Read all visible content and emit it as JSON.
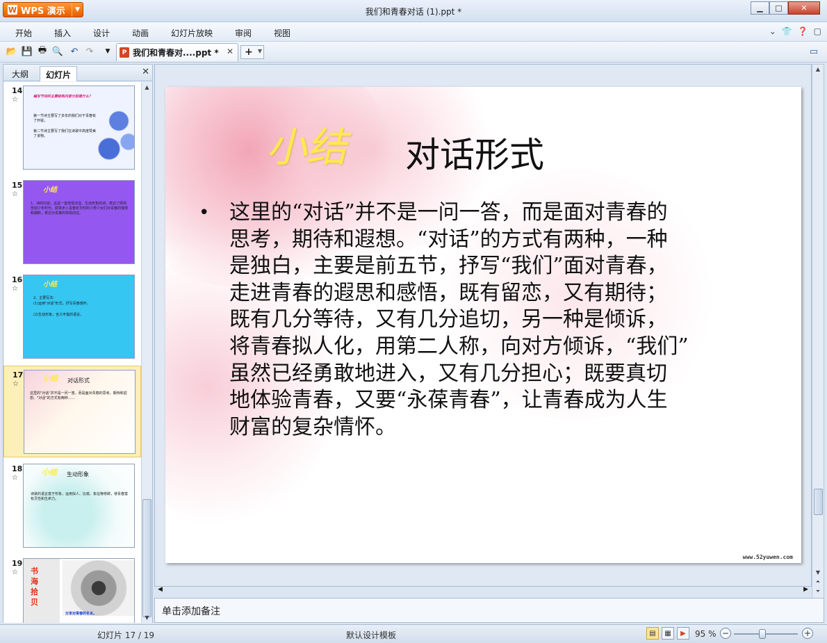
{
  "app": {
    "button_label": "WPS 演示",
    "window_title": "我们和青春对话 (1).ppt *"
  },
  "menu": [
    "开始",
    "插入",
    "设计",
    "动画",
    "幻灯片放映",
    "审阅",
    "视图"
  ],
  "toolbar": {
    "doc_tab_title": "我们和青春对....ppt *",
    "new_tab": "+"
  },
  "left_panel": {
    "tabs": [
      "大纲",
      "幻灯片"
    ],
    "active_tab": "幻灯片",
    "thumbnails": [
      {
        "num": "14",
        "title": "编写节诗的主要结构内容分别是什么？",
        "lines": [
          "第一节诗主要写了多年的我们对于青春有了怀疑，",
          "第二节诗主要写了我们在诗歌中高度赞美了该物。"
        ],
        "bg": "#eef3ff"
      },
      {
        "num": "15",
        "title": "小结",
        "lines": [
          "1、诗的内容，这是一首热情洋溢、生动形象的诗，表达了即将告别少年时代、即将步入青春年华时的少男少女们对青春的憧憬和期盼，表达对青春的热情向往。"
        ],
        "bg": "#9458f0"
      },
      {
        "num": "16",
        "title": "小结",
        "lines": [
          "2、主要写法：",
          "(1)运用\"对话\"形式，抒写青春感怀。",
          "(2)生动形象，含义丰富的语言。"
        ],
        "bg": "#36c6f2"
      },
      {
        "num": "17",
        "title": "小结",
        "subtitle": "对话形式",
        "lines": [
          "这里的\"对话\"并不是一问一答，而是面对青春的思考，期待和遐想。\"对话\"的方式有两种……"
        ],
        "bg": "#fff7ec"
      },
      {
        "num": "18",
        "title": "小结",
        "subtitle": "生动形象",
        "lines": [
          "诗歌的语言富于形象，运用拟人、比喻、象征等修辞，使青春富有灵性和生命力。"
        ],
        "bg": "#f3fbfb"
      },
      {
        "num": "19",
        "title": "书海拾贝",
        "lines": [
          "分享对青春的名言。"
        ],
        "bg": "#ffffff"
      }
    ]
  },
  "slide": {
    "title_a": "小结",
    "title_b": "对话形式",
    "bullet": "•",
    "body": "这里的“对话”并不是一问一答，而是面对青春的\n思考，期待和遐想。“对话”的方式有两种，一种\n是独白，主要是前五节，抒写“我们”面对青春，\n走进青春的遐思和感悟，既有留恋，又有期待；\n既有几分等待，又有几分追切，另一种是倾诉，\n将青春拟人化，用第二人称，向对方倾诉，“我们”\n虽然已经勇敢地进入，又有几分担心；既要真切\n地体验青春，又要“永葆青春”，让青春成为人生\n财富的复杂情怀。",
    "watermark": "www.52yuwen.com"
  },
  "notes": {
    "placeholder": "单击添加备注"
  },
  "status": {
    "slide_counter": "幻灯片 17 / 19",
    "template": "默认设计模板",
    "zoom": "95 %",
    "zoom_level": 0.45
  },
  "colors": {
    "accent": "#e65c00",
    "selected_thumb": "#fcf0b8",
    "title_yellow": "#ffe94d"
  }
}
